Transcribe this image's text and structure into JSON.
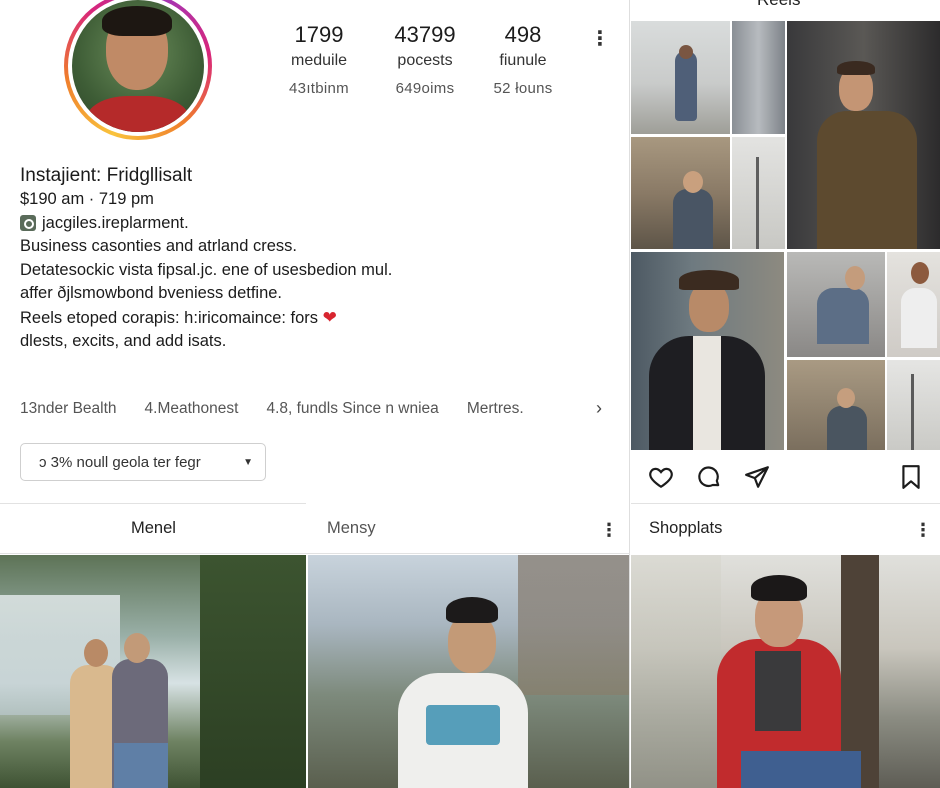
{
  "profile": {
    "stats": [
      {
        "value": "1799",
        "label": "meduile",
        "sub": "43ıtbinm"
      },
      {
        "value": "43799",
        "label": "pocests",
        "sub": "649oims"
      },
      {
        "value": "498",
        "label": "fiunule",
        "sub": "52 łouns"
      }
    ]
  },
  "bio": {
    "name": "Instajient: Fridgllisalt",
    "time": "$190 am · 719 pm",
    "link": "jacgiles.ireplarment.",
    "lines": [
      "Business casonties and atrland cress.",
      "Detatesockic vista fipsal.jc. ene of usesbedion mul.",
      "affer ðjlsmowbond bveniess detfine.",
      "Reels etoped corapis: h:iricomaince: fors",
      "dlests, excits, and add isats."
    ],
    "heart": "❤"
  },
  "highlights": [
    "13nder Bealth",
    "4.Meathonest",
    "4.8, fundls Since n wniea",
    "Mertres."
  ],
  "highlights_arrow": "›",
  "dropdown": {
    "value": "ɔ 3% noull geola ter fegr",
    "caret": "▼"
  },
  "tabs": {
    "left": "Menel",
    "middle": "Mensy",
    "right": "Shopplats"
  },
  "reels": {
    "title": "Reels"
  },
  "menu_glyph": "⋮",
  "icons": {
    "like": "heart-outline-icon",
    "comment": "comment-icon",
    "share": "paper-plane-icon",
    "save": "bookmark-icon"
  },
  "colors": {
    "ring_gradient": [
      "#f9c33c",
      "#ef7d2c",
      "#d8267a",
      "#a335b5"
    ],
    "heart": "#d8252f",
    "divider": "#dedede"
  }
}
